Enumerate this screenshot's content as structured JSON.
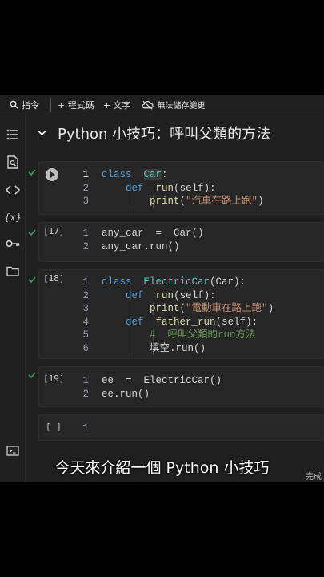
{
  "toolbar": {
    "command_label": "指令",
    "add_code_label": "+ 程式碼",
    "add_text_label": "+ 文字",
    "save_status": "無法儲存變更"
  },
  "rail_icons": [
    "toc-icon",
    "find-icon",
    "code-snippets-icon",
    "variables-icon",
    "secrets-key-icon",
    "files-icon",
    "terminal-icon"
  ],
  "section": {
    "title": "Python 小技巧：呼叫父類的方法"
  },
  "cells": [
    {
      "exec": "",
      "lines": [
        "1",
        "2",
        "3"
      ]
    },
    {
      "exec": "[17]",
      "lines": [
        "1",
        "2"
      ]
    },
    {
      "exec": "[18]",
      "lines": [
        "1",
        "2",
        "3",
        "4",
        "5",
        "6"
      ]
    },
    {
      "exec": "[19]",
      "lines": [
        "1",
        "2"
      ]
    },
    {
      "exec": "[ ]",
      "lines": [
        "1"
      ]
    }
  ],
  "code": {
    "c1": {
      "l1a": "class",
      "l1b": "Car",
      "l1c": ":",
      "l2a": "def",
      "l2b": "run",
      "l2c": "(self):",
      "l3a": "print",
      "l3b": "(",
      "l3c": "\"汽車在路上跑\"",
      "l3d": ")"
    },
    "c2": {
      "l1": "any_car  =  Car()",
      "l2": "any_car.run()"
    },
    "c3": {
      "l1a": "class",
      "l1b": "ElectricCar",
      "l1c": "(Car):",
      "l2a": "def",
      "l2b": "run",
      "l2c": "(self):",
      "l3a": "print",
      "l3b": "(",
      "l3c": "\"電動車在路上跑\"",
      "l3d": ")",
      "l4a": "def",
      "l4b": "father_run",
      "l4c": "(self):",
      "l5": "#  呼叫父類的run方法",
      "l6": "填空.run()"
    },
    "c4": {
      "l1": "ee  =  ElectricCar()",
      "l2": "ee.run()"
    }
  },
  "caption": "今天來介紹一個 Python 小技巧",
  "status_right": "完成"
}
